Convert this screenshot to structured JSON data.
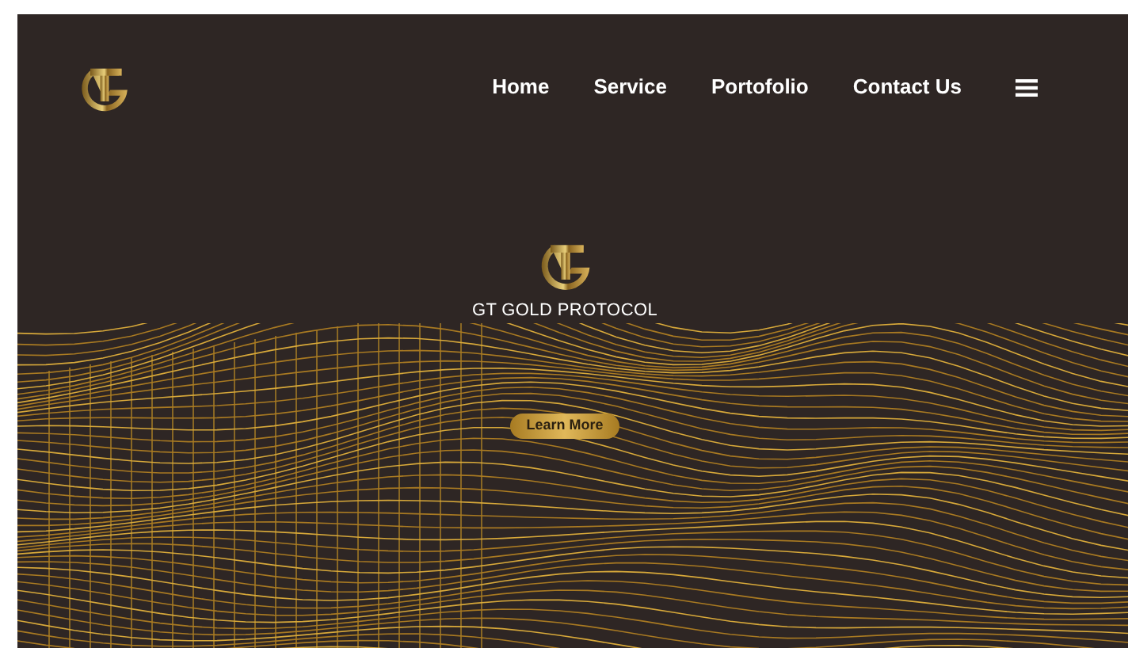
{
  "nav": {
    "items": [
      {
        "label": "Home"
      },
      {
        "label": "Service"
      },
      {
        "label": "Portofolio"
      },
      {
        "label": "Contact Us"
      }
    ]
  },
  "hero": {
    "title": "GT GOLD PROTOCOL",
    "button": "Learn More"
  }
}
